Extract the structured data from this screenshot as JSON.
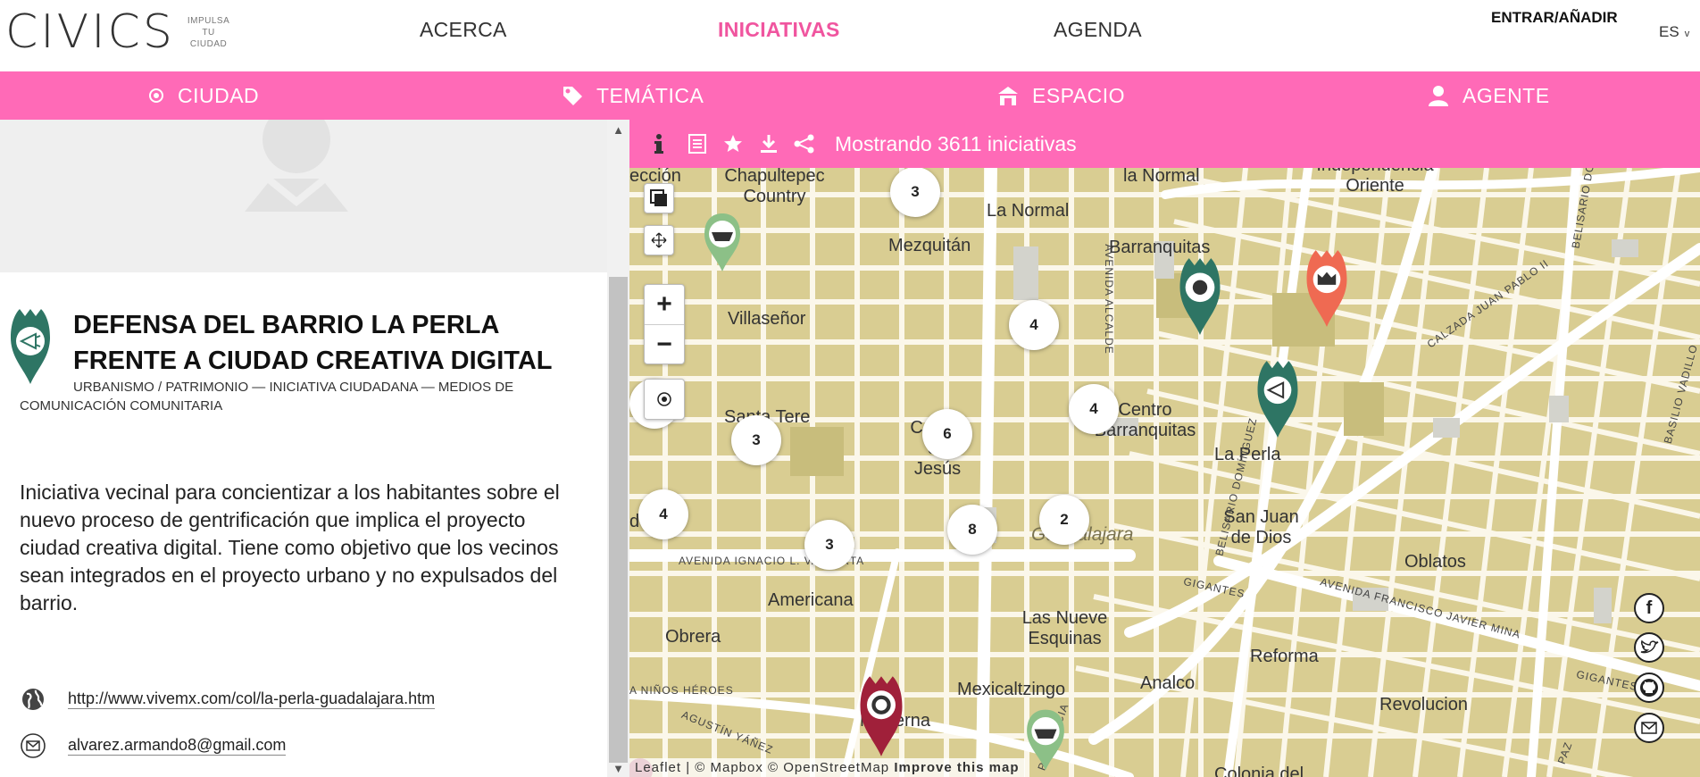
{
  "header": {
    "logo": "CIVICS",
    "tagline": [
      "IMPULSA",
      "TU",
      "CIUDAD"
    ],
    "nav": [
      "ACERCA",
      "INICIATIVAS",
      "AGENDA"
    ],
    "login": "ENTRAR/AÑADIR",
    "language": "ES",
    "active_color": "#f0559f"
  },
  "filters": [
    {
      "icon": "location-dot-icon",
      "label": "CIUDAD"
    },
    {
      "icon": "tag-icon",
      "label": "TEMÁTICA"
    },
    {
      "icon": "building-icon",
      "label": "ESPACIO"
    },
    {
      "icon": "person-icon",
      "label": "AGENTE"
    }
  ],
  "initiative": {
    "title": "DEFENSA DEL BARRIO LA PERLA FRENTE A CIUDAD CREATIVA DIGITAL",
    "tags": "URBANISMO / PATRIMONIO — INICIATIVA CIUDADANA — MEDIOS DE COMUNICACIÓN COMUNITARIA",
    "description": "Iniciativa vecinal para concientizar a los habitantes sobre el nuevo proceso de gentrificación que implica el proyecto ciudad creativa digital. Tiene como objetivo que los vecinos sean integrados en el proyecto urbano y no expulsados del barrio.",
    "website": "http://www.vivemx.com/col/la-perla-guadalajara.htm",
    "email": "alvarez.armando8@gmail.com"
  },
  "map": {
    "count_text": "Mostrando 3611 iniciativas",
    "toolbar_icons": [
      "info-icon",
      "list-icon",
      "star-icon",
      "download-icon",
      "share-icon"
    ],
    "clusters": [
      "3",
      "3",
      "4",
      "4",
      "6",
      "3",
      "4",
      "8",
      "2",
      "3"
    ],
    "labels": {
      "chapultepec": "Chapultepec Country",
      "la_normal_top": "la Normal",
      "independencia": "Independencia Oriente",
      "la_normal": "La Normal",
      "mezquitan": "Mezquitán",
      "barranquitas": "Barranquitas",
      "villasenor": "Villaseñor",
      "santa_tere": "Santa Tere",
      "capilla": "Capilla de Jesús",
      "centro_barranquitas": "Centro Barranquitas",
      "la_perla": "La Perla",
      "san_juan": "San Juan de Dios",
      "oblatos": "Oblatos",
      "americana": "Americana",
      "obrera": "Obrera",
      "las_nueve": "Las Nueve Esquinas",
      "reforma": "Reforma",
      "analco": "Analco",
      "revolucion": "Revolucion",
      "mexicaltzingo": "Mexicaltzingo",
      "moderna": "Moderna",
      "colonia": "Colonia del",
      "guadalajara": "Guadalajara",
      "seccion": "ección",
      "de": "de"
    },
    "streets": {
      "vallarta": "AVENIDA IGNACIO L. VALLARTA",
      "alcalde": "AVENIDA ALCALDE",
      "belisario": "BELISARIO DOMÍNGUEZ",
      "belisario_top": "BELISARIO DOM",
      "juan_pablo": "CALZADA JUAN PABLO II",
      "basilio": "BASILIO VADILLO",
      "gigantes": "GIGANTES",
      "gigantes2": "GIGANTES",
      "javier_mina": "AVENIDA FRANCISCO JAVIER MINA",
      "ninos_heroes": "A NIÑOS HÉROES",
      "agustin": "AGUSTÍN YÁÑEZ",
      "independencia_st": "PENDENCIA",
      "paz": "PAZ"
    },
    "attribution": {
      "prefix": "Leaflet | © Mapbox © OpenStreetMap",
      "improve": "Improve this map"
    },
    "social": [
      "facebook-icon",
      "twitter-icon",
      "github-icon",
      "mail-icon"
    ],
    "colors": {
      "map": "#d9cd92",
      "roads": "#ffffff",
      "park": "#c8bd7c",
      "teal": "#2e7564",
      "green": "#8cc087",
      "orange": "#ef6a52",
      "maroon": "#a0203a",
      "pink": "#ff6ab7"
    }
  }
}
